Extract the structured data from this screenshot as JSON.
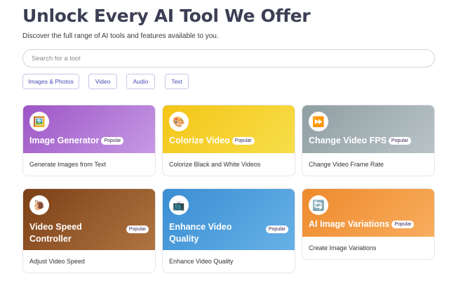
{
  "header": {
    "title": "Unlock Every AI Tool We Offer",
    "subtitle": "Discover the full range of AI tools and features available to you."
  },
  "search": {
    "placeholder": "Search for a tool",
    "value": ""
  },
  "filters": [
    "Images & Photos",
    "Video",
    "Audio",
    "Text"
  ],
  "badge_label": "Popular",
  "cards": [
    {
      "title": "Image Generator",
      "description": "Generate Images from Text",
      "icon": "picture-icon",
      "glyph": "🖼️",
      "popular": true,
      "color": "#9d55c5"
    },
    {
      "title": "Colorize Video",
      "description": "Colorize Black and White Videos",
      "icon": "palette-icon",
      "glyph": "🎨",
      "popular": true,
      "color": "#f3c516"
    },
    {
      "title": "Change Video FPS",
      "description": "Change Video Frame Rate",
      "icon": "fast-forward-icon",
      "glyph": "⏩",
      "popular": true,
      "color": "#8f9ea3"
    },
    {
      "title": "Video Speed Controller",
      "description": "Adjust Video Speed",
      "icon": "snail-icon",
      "glyph": "🐌",
      "popular": true,
      "color": "#7c3f16"
    },
    {
      "title": "Enhance Video Quality",
      "description": "Enhance Video Quality",
      "icon": "tv-icon",
      "glyph": "📺",
      "popular": true,
      "color": "#3a8ed3"
    },
    {
      "title": "AI Image Variations",
      "description": "Create Image Variations",
      "icon": "refresh-image-icon",
      "glyph": "🔄",
      "popular": true,
      "color": "#ee8a2c"
    }
  ]
}
